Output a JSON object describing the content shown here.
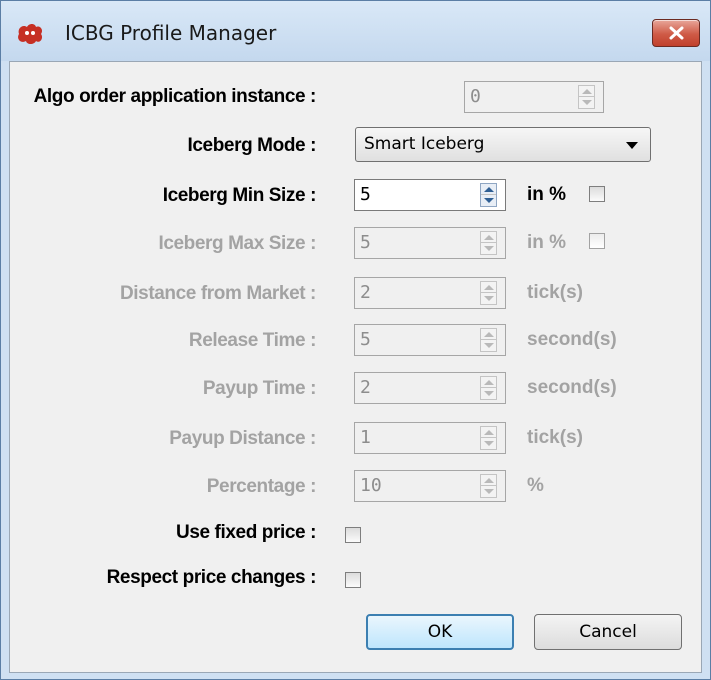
{
  "window": {
    "title": "ICBG Profile Manager"
  },
  "form": {
    "algo_label": "Algo order application instance :",
    "algo_value": "0",
    "mode_label": "Iceberg Mode :",
    "mode_value": "Smart Iceberg",
    "min_label": "Iceberg Min Size :",
    "min_value": "5",
    "min_unit": "in %",
    "min_pct_checked": false,
    "max_label": "Iceberg Max Size :",
    "max_value": "5",
    "max_unit": "in %",
    "max_pct_checked": false,
    "dist_label": "Distance from Market :",
    "dist_value": "2",
    "dist_unit": "tick(s)",
    "release_label": "Release Time :",
    "release_value": "5",
    "release_unit": "second(s)",
    "payup_time_label": "Payup Time :",
    "payup_time_value": "2",
    "payup_time_unit": "second(s)",
    "payup_dist_label": "Payup Distance :",
    "payup_dist_value": "1",
    "payup_dist_unit": "tick(s)",
    "pct_label": "Percentage :",
    "pct_value": "10",
    "pct_unit": "%",
    "fixed_label": "Use fixed price :",
    "fixed_checked": false,
    "respect_label": "Respect price changes :",
    "respect_checked": false
  },
  "buttons": {
    "ok": "OK",
    "cancel": "Cancel"
  },
  "colors": {
    "title_bg": "#cfe0f2",
    "close": "#c7432f",
    "disabled_text": "#a3a3a3"
  }
}
